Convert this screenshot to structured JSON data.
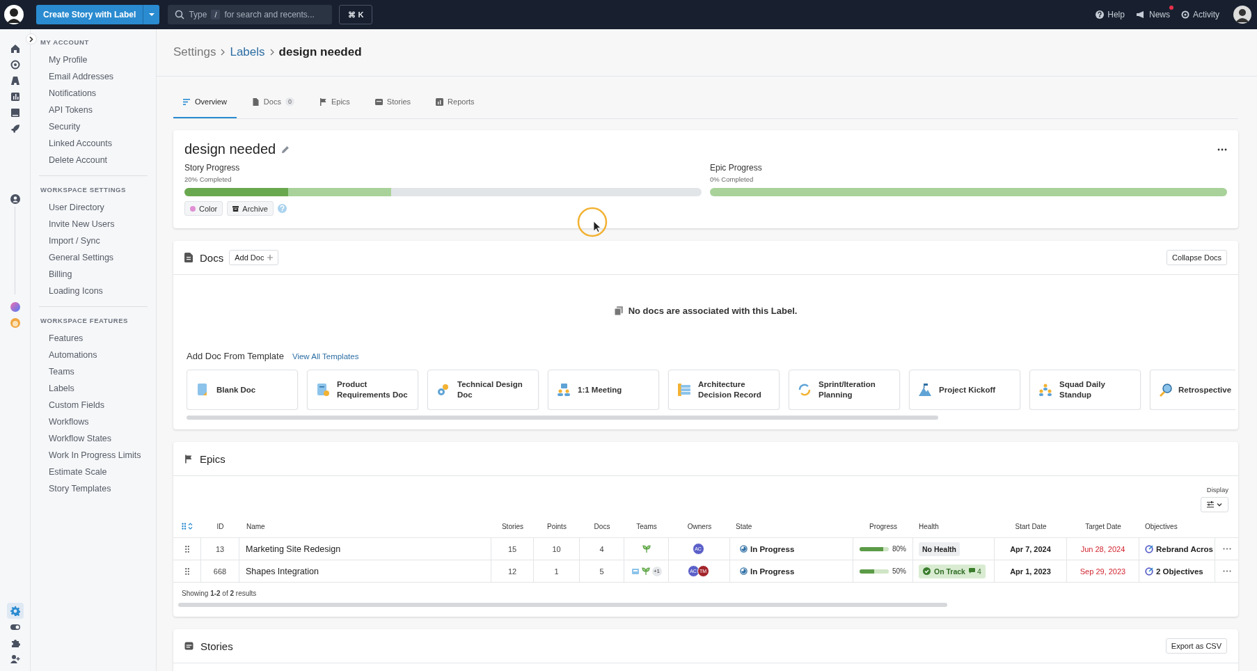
{
  "topbar": {
    "create_button": "Create Story with Label",
    "search": {
      "prefix": "Type",
      "key": "/",
      "placeholder": "for search and recents..."
    },
    "shortcut": "⌘ K",
    "links": [
      {
        "kind": "help",
        "label": "Help",
        "badge": false
      },
      {
        "kind": "news",
        "label": "News",
        "badge": true
      },
      {
        "kind": "activity",
        "label": "Activity",
        "badge": false
      }
    ]
  },
  "rail": [
    {
      "kind": "home",
      "selected": false
    },
    {
      "kind": "target",
      "selected": false
    },
    {
      "kind": "road",
      "selected": false
    },
    {
      "kind": "chart",
      "selected": false
    },
    {
      "kind": "book",
      "selected": false
    },
    {
      "kind": "rocket",
      "selected": false
    },
    {
      "kind": "person",
      "selected": false
    },
    {
      "kind": "gradient",
      "selected": false
    },
    {
      "kind": "avatar",
      "selected": false
    },
    {
      "kind": "gear",
      "selected": true
    },
    {
      "kind": "toggle",
      "selected": false
    },
    {
      "kind": "puzzle",
      "selected": false
    },
    {
      "kind": "user-plus",
      "selected": false
    }
  ],
  "sidebar": {
    "sections": [
      {
        "title": "MY ACCOUNT",
        "items": [
          "My Profile",
          "Email Addresses",
          "Notifications",
          "API Tokens",
          "Security",
          "Linked Accounts",
          "Delete Account"
        ]
      },
      {
        "title": "WORKSPACE SETTINGS",
        "items": [
          "User Directory",
          "Invite New Users",
          "Import / Sync",
          "General Settings",
          "Billing",
          "Loading Icons"
        ]
      },
      {
        "title": "WORKSPACE FEATURES",
        "items": [
          "Features",
          "Automations",
          "Teams",
          "Labels",
          "Custom Fields",
          "Workflows",
          "Workflow States",
          "Work In Progress Limits",
          "Estimate Scale",
          "Story Templates"
        ]
      }
    ]
  },
  "breadcrumb": [
    {
      "kind": "plain",
      "label": "Settings"
    },
    {
      "kind": "link",
      "label": "Labels"
    },
    {
      "kind": "current",
      "label": "design needed"
    }
  ],
  "tabs": [
    {
      "kind": "overview",
      "label": "Overview",
      "selected": true
    },
    {
      "kind": "docs",
      "label": "Docs",
      "count": "0",
      "selected": false
    },
    {
      "kind": "epics",
      "label": "Epics",
      "selected": false
    },
    {
      "kind": "stories",
      "label": "Stories",
      "selected": false
    },
    {
      "kind": "reports",
      "label": "Reports",
      "selected": false
    }
  ],
  "label": {
    "name": "design needed",
    "progress": [
      {
        "title": "Story Progress",
        "reading": "20% Completed",
        "segments": [
          {
            "kind": "done",
            "level": 0.2
          },
          {
            "kind": "started",
            "level": 0.2
          }
        ]
      },
      {
        "title": "Epic Progress",
        "reading": "0% Completed",
        "segments": [
          {
            "kind": "done",
            "level": 0
          },
          {
            "kind": "started",
            "level": 1
          }
        ]
      }
    ],
    "actions": [
      {
        "kind": "color",
        "label": "Color"
      },
      {
        "kind": "archive",
        "label": "Archive"
      }
    ]
  },
  "docs": {
    "title": "Docs",
    "add_button": "Add Doc",
    "collapse_button": "Collapse Docs",
    "empty": "No docs are associated with this Label.",
    "template_title": "Add Doc From Template",
    "template_link": "View All Templates",
    "templates": [
      {
        "kind": "blank",
        "label": "Blank Doc"
      },
      {
        "kind": "prd",
        "label": "Product Requirements Doc"
      },
      {
        "kind": "tech",
        "label": "Technical Design Doc"
      },
      {
        "kind": "meeting",
        "label": "1:1 Meeting"
      },
      {
        "kind": "adr",
        "label": "Architecture Decision Record"
      },
      {
        "kind": "sprint",
        "label": "Sprint/Iteration Planning"
      },
      {
        "kind": "kickoff",
        "label": "Project Kickoff"
      },
      {
        "kind": "standup",
        "label": "Squad Daily Standup"
      },
      {
        "kind": "retro",
        "label": "Retrospective"
      }
    ]
  },
  "epics": {
    "title": "Epics",
    "display_label": "Display",
    "columns": [
      "ID",
      "Name",
      "Stories",
      "Points",
      "Docs",
      "Teams",
      "Owners",
      "State",
      "Progress",
      "Health",
      "Start Date",
      "Target Date",
      "Objectives"
    ],
    "rows": [
      {
        "id": "13",
        "name": "Marketing Site Redesign",
        "stories": "15",
        "points": "10",
        "docs": "4",
        "teams": [
          {
            "kind": "leaf"
          }
        ],
        "owners": [
          {
            "initials": "AC",
            "color": "#5a5fc8"
          }
        ],
        "state": "In Progress",
        "progress": {
          "level": 0.8,
          "reading": "80%"
        },
        "health": {
          "kind": "none",
          "label": "No Health"
        },
        "start": "Apr 7, 2024",
        "target": "Jun 28, 2024",
        "overdue": true,
        "objective": "Rebrand Acros"
      },
      {
        "id": "668",
        "name": "Shapes Integration",
        "stories": "12",
        "points": "1",
        "docs": "5",
        "teams": [
          {
            "kind": "board"
          },
          {
            "kind": "leaf"
          }
        ],
        "teams_extra": "+1",
        "owners": [
          {
            "initials": "AC",
            "color": "#5a5fc8"
          },
          {
            "initials": "TM",
            "color": "#a3232b"
          }
        ],
        "state": "In Progress",
        "progress": {
          "level": 0.5,
          "reading": "50%"
        },
        "health": {
          "kind": "on_track",
          "label": "On Track",
          "comments": "4"
        },
        "start": "Apr 1, 2023",
        "target": "Sep 29, 2023",
        "overdue": true,
        "objective": "2 Objectives"
      }
    ],
    "footer": "Showing **1-2** of **2** results"
  },
  "stories": {
    "title": "Stories",
    "export_button": "Export as CSV"
  }
}
